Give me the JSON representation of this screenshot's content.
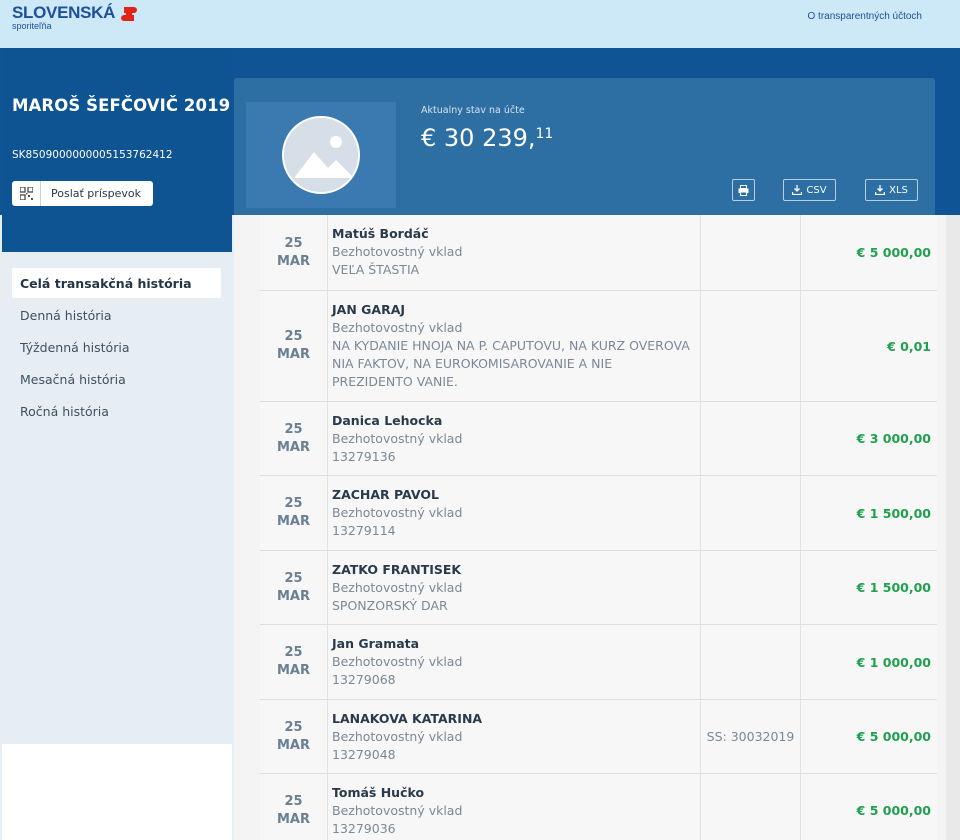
{
  "header": {
    "logo_main": "SLOVENSKÁ",
    "logo_sub": "sporiteľňa",
    "link": "O transparentných účtoch",
    "brand_color": "#1d4f9c",
    "accent_red": "#e2231a"
  },
  "account": {
    "name": "MAROŠ ŠEFČOVIČ 2019",
    "iban": "SK8509000000005153762412",
    "donate_label": "Poslať príspevok",
    "balance_label": "Aktualny stav na účte",
    "balance_main": "€ 30 239,",
    "balance_cents": "11"
  },
  "sidebar": {
    "items": [
      {
        "label": "Celá transakčná história",
        "active": true
      },
      {
        "label": "Denná história",
        "active": false
      },
      {
        "label": "Týždenná história",
        "active": false
      },
      {
        "label": "Mesačná história",
        "active": false
      },
      {
        "label": "Ročná história",
        "active": false
      }
    ]
  },
  "toolbar": {
    "print_icon": "printer-icon",
    "csv_label": "CSV",
    "xls_label": "XLS"
  },
  "transactions": [
    {
      "day": "25",
      "month": "MAR",
      "name": "Matúš Bordáč",
      "type": "Bezhotovostný vklad",
      "note": "VEĽA ŠTASTIA",
      "ref": "",
      "amount": "€ 5 000,00"
    },
    {
      "day": "25",
      "month": "MAR",
      "name": "JAN GARAJ",
      "type": "Bezhotovostný vklad",
      "note": "NA KYDANIE HNOJA NA P. CAPUTOVU, NA KURZ OVEROVA NIA FAKTOV, NA EUROKOMISAROVANIE A NIE PREZIDENTO VANIE.",
      "ref": "",
      "amount": "€ 0,01"
    },
    {
      "day": "25",
      "month": "MAR",
      "name": "Danica Lehocka",
      "type": "Bezhotovostný vklad",
      "note": "13279136",
      "ref": "",
      "amount": "€ 3 000,00"
    },
    {
      "day": "25",
      "month": "MAR",
      "name": "ZACHAR PAVOL",
      "type": "Bezhotovostný vklad",
      "note": "13279114",
      "ref": "",
      "amount": "€ 1 500,00"
    },
    {
      "day": "25",
      "month": "MAR",
      "name": "ZATKO FRANTISEK",
      "type": "Bezhotovostný vklad",
      "note": "SPONZORSKÝ DAR",
      "ref": "",
      "amount": "€ 1 500,00"
    },
    {
      "day": "25",
      "month": "MAR",
      "name": "Jan Gramata",
      "type": "Bezhotovostný vklad",
      "note": "13279068",
      "ref": "",
      "amount": "€ 1 000,00"
    },
    {
      "day": "25",
      "month": "MAR",
      "name": "LANAKOVA KATARINA",
      "type": "Bezhotovostný vklad",
      "note": "13279048",
      "ref": "SS: 30032019",
      "amount": "€ 5 000,00"
    },
    {
      "day": "25",
      "month": "MAR",
      "name": "Tomáš Hučko",
      "type": "Bezhotovostný vklad",
      "note": "13279036",
      "ref": "",
      "amount": "€ 5 000,00"
    }
  ]
}
